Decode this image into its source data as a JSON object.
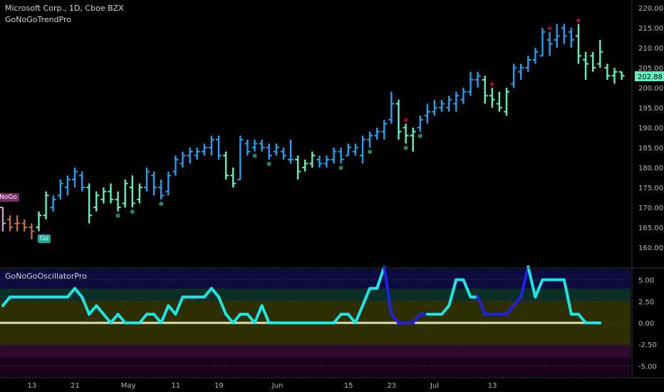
{
  "header": {
    "symbol": "Microsoft Corp., 1D, Cboe BZX",
    "indicator": "GoNoGoTrendPro",
    "oscillator": "GoNoGoOscillatorPro"
  },
  "badges": {
    "nogo": "NoGo",
    "go": "Go"
  },
  "colors": {
    "go_strong": "#1da1f2",
    "go_weak": "#5ef0c2",
    "nogo_strong": "#c06a45",
    "nogo_weak": "#d89bd0",
    "osc_high": "#19e6e6",
    "osc_low": "#2020e6",
    "zero_line": "#e0e0b0",
    "price_tag": "#5ef0c2",
    "dot": "#1f8a5a",
    "cross": "#b0103a"
  },
  "chart_data": [
    {
      "type": "ohlc",
      "title": "Microsoft Corp., 1D, Cboe BZX",
      "ylim": [
        155,
        222
      ],
      "yticks": [
        "220.00",
        "215.00",
        "210.00",
        "205.00",
        "200.00",
        "195.00",
        "190.00",
        "185.00",
        "180.00",
        "175.00",
        "170.00",
        "165.00",
        "160.00"
      ],
      "last_price": "202.88",
      "x_labels": [
        {
          "label": "13",
          "index": 4
        },
        {
          "label": "21",
          "index": 10
        },
        {
          "label": "May",
          "index": 17
        },
        {
          "label": "11",
          "index": 24
        },
        {
          "label": "19",
          "index": 30
        },
        {
          "label": "Jun",
          "index": 38
        },
        {
          "label": "15",
          "index": 48
        },
        {
          "label": "23",
          "index": 54
        },
        {
          "label": "Jul",
          "index": 60
        },
        {
          "label": "13",
          "index": 68
        }
      ],
      "bars": [
        {
          "o": 170,
          "h": 170,
          "l": 164,
          "c": 166,
          "s": "nw"
        },
        {
          "o": 167,
          "h": 168,
          "l": 164,
          "c": 165,
          "s": "ns"
        },
        {
          "o": 166,
          "h": 168,
          "l": 164,
          "c": 166,
          "s": "ns"
        },
        {
          "o": 166,
          "h": 167,
          "l": 164,
          "c": 165,
          "s": "ns"
        },
        {
          "o": 165,
          "h": 166,
          "l": 162,
          "c": 164,
          "s": "ns"
        },
        {
          "o": 165,
          "h": 169,
          "l": 164,
          "c": 168,
          "s": "gw"
        },
        {
          "o": 168,
          "h": 174,
          "l": 167,
          "c": 173,
          "s": "gw"
        },
        {
          "o": 170,
          "h": 173,
          "l": 169,
          "c": 172,
          "s": "gs"
        },
        {
          "o": 173,
          "h": 177,
          "l": 172,
          "c": 176,
          "s": "gs"
        },
        {
          "o": 175,
          "h": 178,
          "l": 173,
          "c": 177,
          "s": "gs"
        },
        {
          "o": 177,
          "h": 180,
          "l": 175,
          "c": 179,
          "s": "gs"
        },
        {
          "o": 178,
          "h": 179,
          "l": 174,
          "c": 175,
          "s": "gs"
        },
        {
          "o": 175,
          "h": 176,
          "l": 166,
          "c": 168,
          "s": "gw"
        },
        {
          "o": 170,
          "h": 174,
          "l": 169,
          "c": 173,
          "s": "gw"
        },
        {
          "o": 172,
          "h": 175,
          "l": 171,
          "c": 174,
          "s": "gw"
        },
        {
          "o": 174,
          "h": 176,
          "l": 171,
          "c": 172,
          "s": "gw"
        },
        {
          "o": 172,
          "h": 174,
          "l": 169,
          "c": 170,
          "s": "gw"
        },
        {
          "o": 171,
          "h": 177,
          "l": 170,
          "c": 176,
          "s": "gw"
        },
        {
          "o": 175,
          "h": 178,
          "l": 170,
          "c": 171,
          "s": "gw"
        },
        {
          "o": 172,
          "h": 176,
          "l": 171,
          "c": 175,
          "s": "gw"
        },
        {
          "o": 175,
          "h": 180,
          "l": 174,
          "c": 179,
          "s": "gs"
        },
        {
          "o": 178,
          "h": 179,
          "l": 173,
          "c": 175,
          "s": "gs"
        },
        {
          "o": 175,
          "h": 177,
          "l": 172,
          "c": 173,
          "s": "gs"
        },
        {
          "o": 174,
          "h": 179,
          "l": 173,
          "c": 178,
          "s": "gs"
        },
        {
          "o": 179,
          "h": 183,
          "l": 178,
          "c": 182,
          "s": "gs"
        },
        {
          "o": 181,
          "h": 184,
          "l": 180,
          "c": 183,
          "s": "gs"
        },
        {
          "o": 183,
          "h": 185,
          "l": 181,
          "c": 184,
          "s": "gs"
        },
        {
          "o": 183,
          "h": 185,
          "l": 182,
          "c": 184,
          "s": "gs"
        },
        {
          "o": 184,
          "h": 186,
          "l": 183,
          "c": 185,
          "s": "gs"
        },
        {
          "o": 185,
          "h": 188,
          "l": 183,
          "c": 187,
          "s": "gs"
        },
        {
          "o": 187,
          "h": 188,
          "l": 182,
          "c": 183,
          "s": "gs"
        },
        {
          "o": 183,
          "h": 184,
          "l": 177,
          "c": 178,
          "s": "gw"
        },
        {
          "o": 178,
          "h": 180,
          "l": 175,
          "c": 176,
          "s": "gw"
        },
        {
          "o": 177,
          "h": 188,
          "l": 177,
          "c": 187,
          "s": "gs"
        },
        {
          "o": 186,
          "h": 187,
          "l": 183,
          "c": 184,
          "s": "gs"
        },
        {
          "o": 185,
          "h": 187,
          "l": 184,
          "c": 186,
          "s": "gs"
        },
        {
          "o": 186,
          "h": 187,
          "l": 184,
          "c": 185,
          "s": "gs"
        },
        {
          "o": 185,
          "h": 186,
          "l": 182,
          "c": 183,
          "s": "gs"
        },
        {
          "o": 184,
          "h": 186,
          "l": 183,
          "c": 185,
          "s": "gs"
        },
        {
          "o": 184,
          "h": 185,
          "l": 182,
          "c": 183,
          "s": "gs"
        },
        {
          "o": 182,
          "h": 187,
          "l": 181,
          "c": 182,
          "s": "gs"
        },
        {
          "o": 182,
          "h": 183,
          "l": 177,
          "c": 179,
          "s": "gw"
        },
        {
          "o": 180,
          "h": 182,
          "l": 179,
          "c": 181,
          "s": "gw"
        },
        {
          "o": 181,
          "h": 184,
          "l": 180,
          "c": 183,
          "s": "gw"
        },
        {
          "o": 182,
          "h": 183,
          "l": 180,
          "c": 181,
          "s": "gs"
        },
        {
          "o": 181,
          "h": 183,
          "l": 180,
          "c": 182,
          "s": "gs"
        },
        {
          "o": 182,
          "h": 185,
          "l": 181,
          "c": 184,
          "s": "gs"
        },
        {
          "o": 184,
          "h": 185,
          "l": 181,
          "c": 182,
          "s": "gs"
        },
        {
          "o": 183,
          "h": 186,
          "l": 183,
          "c": 185,
          "s": "gs"
        },
        {
          "o": 184,
          "h": 186,
          "l": 183,
          "c": 185,
          "s": "gs"
        },
        {
          "o": 183,
          "h": 188,
          "l": 181,
          "c": 187,
          "s": "gs"
        },
        {
          "o": 187,
          "h": 189,
          "l": 185,
          "c": 188,
          "s": "gs"
        },
        {
          "o": 188,
          "h": 190,
          "l": 187,
          "c": 189,
          "s": "gs"
        },
        {
          "o": 189,
          "h": 192,
          "l": 187,
          "c": 191,
          "s": "gs"
        },
        {
          "o": 192,
          "h": 199,
          "l": 191,
          "c": 196,
          "s": "gs"
        },
        {
          "o": 196,
          "h": 197,
          "l": 187,
          "c": 189,
          "s": "gw"
        },
        {
          "o": 190,
          "h": 191,
          "l": 186,
          "c": 188,
          "s": "gw"
        },
        {
          "o": 188,
          "h": 190,
          "l": 184,
          "c": 189,
          "s": "gw"
        },
        {
          "o": 190,
          "h": 193,
          "l": 189,
          "c": 192,
          "s": "gs"
        },
        {
          "o": 193,
          "h": 196,
          "l": 191,
          "c": 194,
          "s": "gs"
        },
        {
          "o": 194,
          "h": 197,
          "l": 193,
          "c": 195,
          "s": "gs"
        },
        {
          "o": 195,
          "h": 197,
          "l": 194,
          "c": 196,
          "s": "gs"
        },
        {
          "o": 195,
          "h": 198,
          "l": 194,
          "c": 197,
          "s": "gs"
        },
        {
          "o": 196,
          "h": 199,
          "l": 194,
          "c": 198,
          "s": "gs"
        },
        {
          "o": 197,
          "h": 200,
          "l": 196,
          "c": 199,
          "s": "gs"
        },
        {
          "o": 199,
          "h": 204,
          "l": 198,
          "c": 202,
          "s": "gs"
        },
        {
          "o": 202,
          "h": 204,
          "l": 200,
          "c": 203,
          "s": "gs"
        },
        {
          "o": 202,
          "h": 203,
          "l": 196,
          "c": 198,
          "s": "gw"
        },
        {
          "o": 198,
          "h": 200,
          "l": 195,
          "c": 197,
          "s": "gw"
        },
        {
          "o": 196,
          "h": 199,
          "l": 194,
          "c": 195,
          "s": "gw"
        },
        {
          "o": 194,
          "h": 200,
          "l": 193,
          "c": 199,
          "s": "gw"
        },
        {
          "o": 201,
          "h": 206,
          "l": 200,
          "c": 205,
          "s": "gs"
        },
        {
          "o": 204,
          "h": 206,
          "l": 202,
          "c": 205,
          "s": "gs"
        },
        {
          "o": 205,
          "h": 208,
          "l": 204,
          "c": 207,
          "s": "gs"
        },
        {
          "o": 207,
          "h": 210,
          "l": 206,
          "c": 209,
          "s": "gs"
        },
        {
          "o": 208,
          "h": 215,
          "l": 208,
          "c": 214,
          "s": "gs"
        },
        {
          "o": 212,
          "h": 214,
          "l": 208,
          "c": 211,
          "s": "gs"
        },
        {
          "o": 212,
          "h": 216,
          "l": 210,
          "c": 213,
          "s": "gs"
        },
        {
          "o": 215,
          "h": 216,
          "l": 211,
          "c": 213,
          "s": "gs"
        },
        {
          "o": 214,
          "h": 215,
          "l": 210,
          "c": 212,
          "s": "gs"
        },
        {
          "o": 213,
          "h": 216,
          "l": 206,
          "c": 208,
          "s": "gw"
        },
        {
          "o": 207,
          "h": 209,
          "l": 202,
          "c": 206,
          "s": "gw"
        },
        {
          "o": 208,
          "h": 209,
          "l": 204,
          "c": 205,
          "s": "gw"
        },
        {
          "o": 206,
          "h": 212,
          "l": 205,
          "c": 209,
          "s": "gw"
        },
        {
          "o": 205,
          "h": 206,
          "l": 202,
          "c": 203,
          "s": "gw"
        },
        {
          "o": 203,
          "h": 205,
          "l": 201,
          "c": 204,
          "s": "gw"
        },
        {
          "o": 204,
          "h": 204,
          "l": 202,
          "c": 203,
          "s": "gw"
        }
      ],
      "dots_below": [
        16,
        18,
        22,
        35,
        37,
        47,
        51,
        56,
        58
      ],
      "crosses_above": [
        56,
        68,
        76,
        80
      ],
      "badge_nogo_index": 0,
      "badge_go_index": 5
    },
    {
      "type": "line",
      "title": "GoNoGoOscillatorPro",
      "ylim": [
        -6.2,
        6.2
      ],
      "yticks": [
        "5.00",
        "2.50",
        "0.00",
        "-2.50",
        "-5.00"
      ],
      "ytick_values": [
        5,
        2.5,
        0,
        -2.5,
        -5
      ],
      "zero_value": 0,
      "bands": [
        {
          "from": 4,
          "to": 6.2,
          "color": "#0b0b3e"
        },
        {
          "from": 2.5,
          "to": 4,
          "color": "#0b2e26"
        },
        {
          "from": 0,
          "to": 2.5,
          "color": "#2e2e00"
        },
        {
          "from": -2.5,
          "to": 0,
          "color": "#2e2e00"
        },
        {
          "from": -4,
          "to": -2.5,
          "color": "#2e0a2e"
        },
        {
          "from": -6.2,
          "to": -4,
          "color": "#1a001a"
        }
      ],
      "values": [
        2,
        3,
        3,
        3,
        3,
        3,
        3,
        3,
        3,
        3,
        4,
        3,
        1,
        2,
        1,
        0,
        1,
        0,
        0,
        0,
        1,
        1,
        0,
        2,
        1,
        3,
        3,
        3,
        3,
        4,
        3,
        1,
        0,
        1,
        1,
        0,
        2,
        0,
        0,
        0,
        0,
        0,
        0,
        0,
        0,
        0,
        0,
        1,
        1,
        0,
        2,
        4,
        4,
        6.5,
        1,
        0,
        0,
        0,
        1,
        1,
        1,
        1,
        2,
        5,
        5,
        3,
        3,
        1,
        1,
        1,
        1,
        2,
        3,
        6.5,
        3,
        5,
        5,
        5,
        5,
        1,
        1,
        0,
        0,
        0
      ]
    }
  ]
}
